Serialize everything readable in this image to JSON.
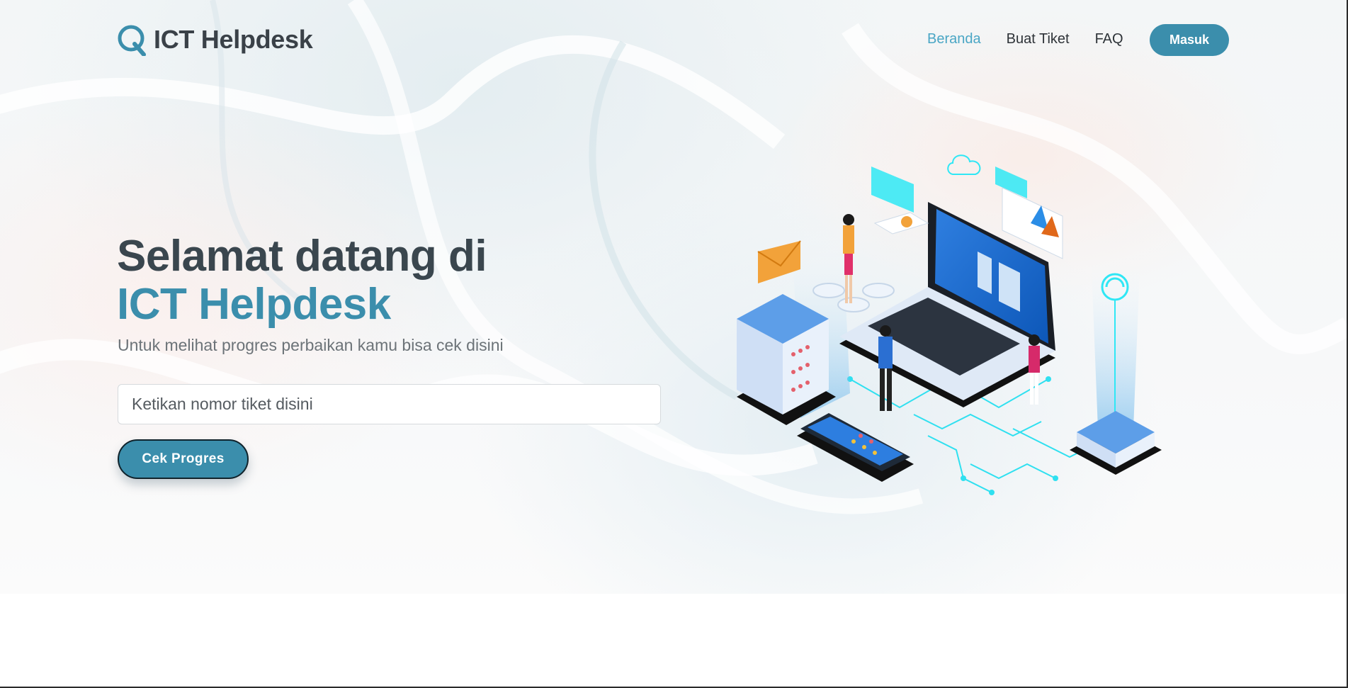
{
  "brand": {
    "name": "ICT Helpdesk",
    "logo_icon": "q-logo-icon",
    "color": "#3b8eac"
  },
  "nav": {
    "links": [
      {
        "label": "Beranda",
        "active": true
      },
      {
        "label": "Buat Tiket",
        "active": false
      },
      {
        "label": "FAQ",
        "active": false
      }
    ],
    "login_label": "Masuk"
  },
  "hero": {
    "title_line1": "Selamat datang di",
    "title_line2": "ICT Helpdesk",
    "subtitle": "Untuk melihat progres perbaikan kamu bisa cek disini",
    "search": {
      "value": "",
      "placeholder": "Ketikan nomor tiket disini"
    },
    "button_label": "Cek Progres",
    "illustration_icon": "isometric-datacenter-illustration"
  },
  "colors": {
    "primary": "#3b8eac",
    "active_link": "#4aa6c5",
    "heading": "#3a464e",
    "subtitle": "#6c7378"
  }
}
